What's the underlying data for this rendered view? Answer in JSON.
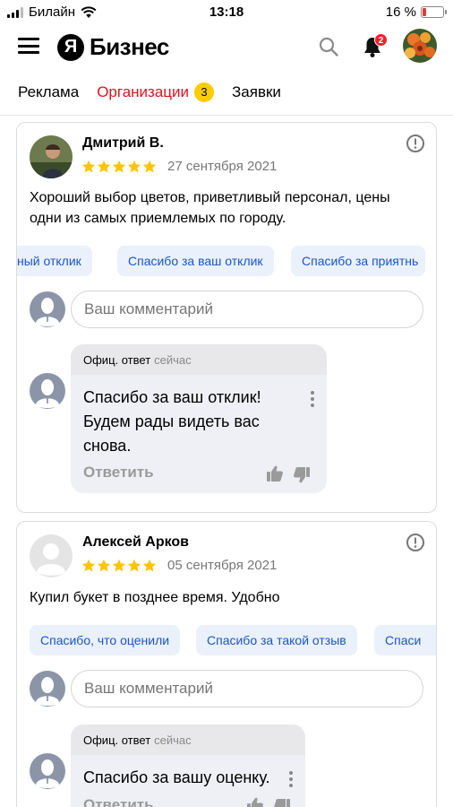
{
  "status_bar": {
    "carrier": "Билайн",
    "time": "13:18",
    "battery_text": "16 %",
    "battery_level": 0.16,
    "battery_color": "#e53935"
  },
  "header": {
    "logo_letter": "Я",
    "logo_text": "Бизнес",
    "notifications_count": "2",
    "icons": [
      "menu-icon",
      "search-icon",
      "bell-icon",
      "user-avatar"
    ]
  },
  "tabs": [
    {
      "label": "Реклама"
    },
    {
      "label": "Организации",
      "count": "3",
      "active": true
    },
    {
      "label": "Заявки"
    }
  ],
  "colors": {
    "accent_red": "#e0121c",
    "badge_yellow": "#ffcc00",
    "chip_bg": "#eaf1fb",
    "chip_text": "#1a56c9",
    "star": "#ffc400"
  },
  "reviews": [
    {
      "author": "Дмитрий В.",
      "rating": 5,
      "date": "27 сентября 2021",
      "text": "Хороший выбор цветов, приветливый персонал, цены одни из самых приемлемых по городу.",
      "quick_replies": [
        "ный отклик",
        "Спасибо за ваш отклик",
        "Спасибо за приятнь"
      ],
      "comment_placeholder": "Ваш комментарий",
      "reply": {
        "label": "Офиц. ответ",
        "time": "сейчас",
        "text": "Спасибо за ваш отклик! Будем рады видеть вас снова.",
        "action": "Ответить"
      }
    },
    {
      "author": "Алексей Арков",
      "rating": 5,
      "date": "05 сентября 2021",
      "text": "Купил букет в позднее время. Удобно",
      "quick_replies": [
        "Спасибо, что оценили",
        "Спасибо за такой отзыв",
        "Спаси"
      ],
      "comment_placeholder": "Ваш комментарий",
      "reply": {
        "label": "Офиц. ответ",
        "time": "сейчас",
        "text": "Спасибо за вашу оценку.",
        "action": "Ответить"
      }
    }
  ]
}
